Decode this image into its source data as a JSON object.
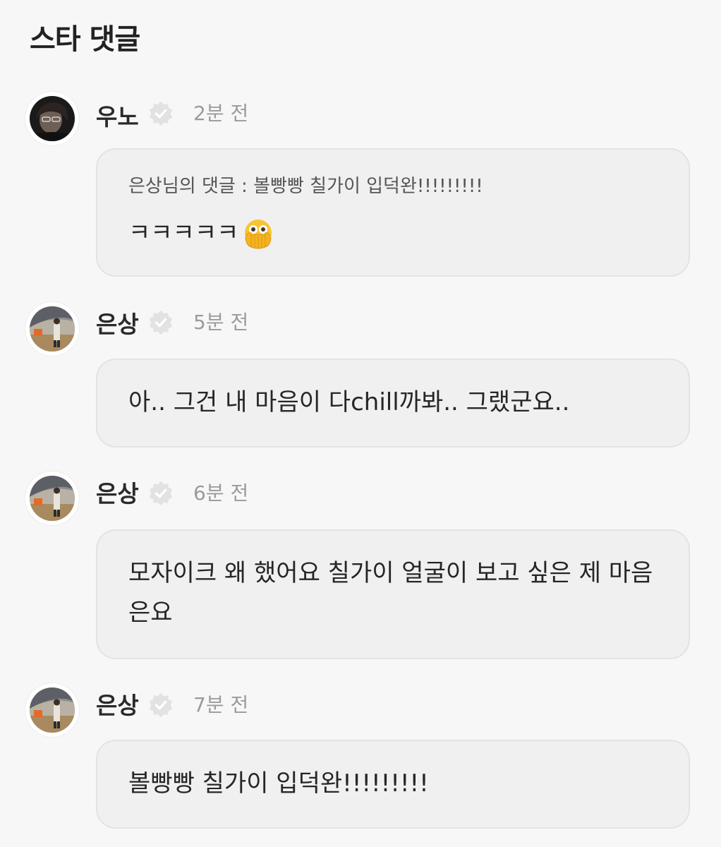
{
  "section": {
    "title": "스타 댓글"
  },
  "colors": {
    "background": "#f7f7f7",
    "bubble": "#f0f0f0",
    "bubble_border": "#e3e3e3",
    "time": "#9b9b9b",
    "verified": "#e2e2e2"
  },
  "comments": [
    {
      "author": "우노",
      "verified_icon": "verified-badge-icon",
      "time": "2분 전",
      "quote": "은상님의 댓글 : 볼빵빵 칠가이 입덕완!!!!!!!!!",
      "text": "ㅋㅋㅋㅋㅋ",
      "emoji": "face-with-open-eyes-and-hand-over-mouth-emoji"
    },
    {
      "author": "은상",
      "verified_icon": "verified-badge-icon",
      "time": "5분 전",
      "text": "아.. 그건 내 마음이 다chill까봐.. 그랬군요.."
    },
    {
      "author": "은상",
      "verified_icon": "verified-badge-icon",
      "time": "6분 전",
      "text": "모자이크 왜 했어요 칠가이 얼굴이 보고 싶은 제 마음은요"
    },
    {
      "author": "은상",
      "verified_icon": "verified-badge-icon",
      "time": "7분 전",
      "text": "볼빵빵 칠가이 입덕완!!!!!!!!!"
    }
  ]
}
